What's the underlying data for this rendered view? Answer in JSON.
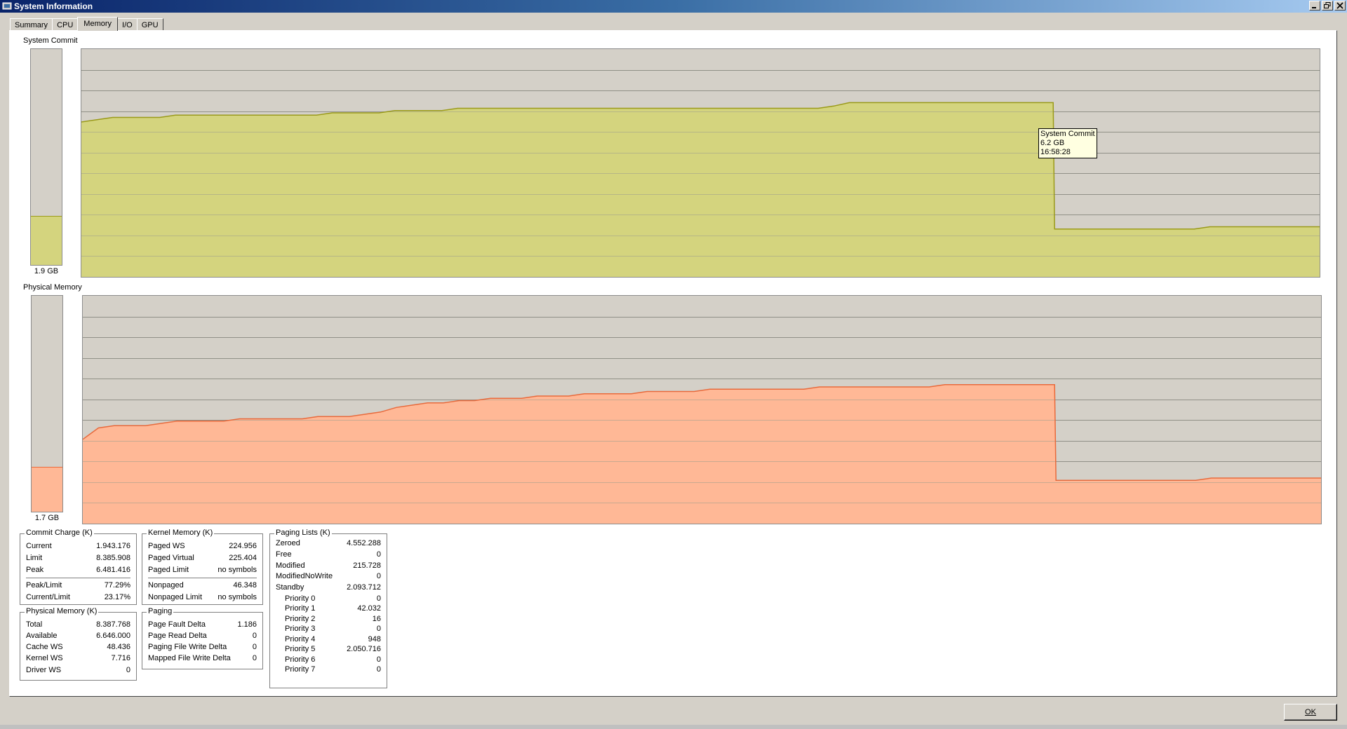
{
  "window": {
    "title": "System Information",
    "controls": [
      "minimize",
      "restore",
      "close"
    ]
  },
  "tabs": [
    {
      "label": "Summary",
      "active": false
    },
    {
      "label": "CPU",
      "active": false
    },
    {
      "label": "Memory",
      "active": true
    },
    {
      "label": "I/O",
      "active": false
    },
    {
      "label": "GPU",
      "active": false
    }
  ],
  "system_commit": {
    "title": "System Commit",
    "gauge_label": "1.9 GB",
    "gauge_fraction": 0.2273,
    "color_fill": "#d4d47e",
    "color_line": "#9a9a1a",
    "tooltip": {
      "line1": "System Commit",
      "line2": "6.2 GB",
      "line3": "16:58:28"
    }
  },
  "physical_memory": {
    "title": "Physical Memory",
    "gauge_label": "1.7 GB",
    "gauge_fraction": 0.207,
    "color_fill": "#ffb896",
    "color_line": "#e86a3c"
  },
  "chart_data": [
    {
      "type": "area",
      "name": "System Commit history",
      "ylim": [
        0,
        1
      ],
      "values": [
        0.68,
        0.69,
        0.7,
        0.7,
        0.7,
        0.7,
        0.71,
        0.71,
        0.71,
        0.71,
        0.71,
        0.71,
        0.71,
        0.71,
        0.71,
        0.71,
        0.72,
        0.72,
        0.72,
        0.72,
        0.73,
        0.73,
        0.73,
        0.73,
        0.74,
        0.74,
        0.74,
        0.74,
        0.74,
        0.74,
        0.74,
        0.74,
        0.74,
        0.74,
        0.74,
        0.74,
        0.74,
        0.74,
        0.74,
        0.74,
        0.74,
        0.74,
        0.74,
        0.74,
        0.74,
        0.74,
        0.74,
        0.74,
        0.75,
        0.765,
        0.765,
        0.765,
        0.765,
        0.765,
        0.765,
        0.765,
        0.765,
        0.765,
        0.765,
        0.765,
        0.765,
        0.765,
        0.765,
        0.21,
        0.21,
        0.21,
        0.21,
        0.21,
        0.21,
        0.21,
        0.21,
        0.21,
        0.22,
        0.22,
        0.22,
        0.22,
        0.22,
        0.22,
        0.22,
        0.22
      ],
      "cut_index": 63
    },
    {
      "type": "area",
      "name": "Physical Memory history",
      "ylim": [
        0,
        1
      ],
      "values": [
        0.37,
        0.42,
        0.43,
        0.43,
        0.43,
        0.44,
        0.45,
        0.45,
        0.45,
        0.45,
        0.46,
        0.46,
        0.46,
        0.46,
        0.46,
        0.47,
        0.47,
        0.47,
        0.48,
        0.49,
        0.51,
        0.52,
        0.53,
        0.53,
        0.54,
        0.54,
        0.55,
        0.55,
        0.55,
        0.56,
        0.56,
        0.56,
        0.57,
        0.57,
        0.57,
        0.57,
        0.58,
        0.58,
        0.58,
        0.58,
        0.59,
        0.59,
        0.59,
        0.59,
        0.59,
        0.59,
        0.59,
        0.6,
        0.6,
        0.6,
        0.6,
        0.6,
        0.6,
        0.6,
        0.6,
        0.61,
        0.61,
        0.61,
        0.61,
        0.61,
        0.61,
        0.61,
        0.61,
        0.19,
        0.19,
        0.19,
        0.19,
        0.19,
        0.19,
        0.19,
        0.19,
        0.19,
        0.2,
        0.2,
        0.2,
        0.2,
        0.2,
        0.2,
        0.2,
        0.2
      ],
      "cut_index": 63
    }
  ],
  "commit_charge": {
    "title": "Commit Charge (K)",
    "rows": [
      {
        "label": "Current",
        "value": "1.943.176"
      },
      {
        "label": "Limit",
        "value": "8.385.908"
      },
      {
        "label": "Peak",
        "value": "6.481.416"
      }
    ],
    "rows2": [
      {
        "label": "Peak/Limit",
        "value": "77.29%"
      },
      {
        "label": "Current/Limit",
        "value": "23.17%"
      }
    ]
  },
  "physical_memory_k": {
    "title": "Physical Memory (K)",
    "rows": [
      {
        "label": "Total",
        "value": "8.387.768"
      },
      {
        "label": "Available",
        "value": "6.646.000"
      },
      {
        "label": "Cache WS",
        "value": "48.436"
      },
      {
        "label": "Kernel WS",
        "value": "7.716"
      },
      {
        "label": "Driver WS",
        "value": "0"
      }
    ]
  },
  "kernel_memory": {
    "title": "Kernel Memory (K)",
    "rows": [
      {
        "label": "Paged WS",
        "value": "224.956"
      },
      {
        "label": "Paged Virtual",
        "value": "225.404"
      },
      {
        "label": "Paged Limit",
        "value": "no symbols"
      }
    ],
    "rows2": [
      {
        "label": "Nonpaged",
        "value": "46.348"
      },
      {
        "label": "Nonpaged Limit",
        "value": "no symbols"
      }
    ]
  },
  "paging": {
    "title": "Paging",
    "rows": [
      {
        "label": "Page Fault Delta",
        "value": "1.186"
      },
      {
        "label": "Page Read Delta",
        "value": "0"
      },
      {
        "label": "Paging File Write Delta",
        "value": "0"
      },
      {
        "label": "Mapped File Write Delta",
        "value": "0"
      }
    ]
  },
  "paging_lists": {
    "title": "Paging Lists (K)",
    "rows": [
      {
        "label": "Zeroed",
        "value": "4.552.288"
      },
      {
        "label": "Free",
        "value": "0"
      },
      {
        "label": "Modified",
        "value": "215.728"
      },
      {
        "label": "ModifiedNoWrite",
        "value": "0"
      },
      {
        "label": "Standby",
        "value": "2.093.712"
      }
    ],
    "priorities": [
      {
        "label": "Priority 0",
        "value": "0"
      },
      {
        "label": "Priority 1",
        "value": "42.032"
      },
      {
        "label": "Priority 2",
        "value": "16"
      },
      {
        "label": "Priority 3",
        "value": "0"
      },
      {
        "label": "Priority 4",
        "value": "948"
      },
      {
        "label": "Priority 5",
        "value": "2.050.716"
      },
      {
        "label": "Priority 6",
        "value": "0"
      },
      {
        "label": "Priority 7",
        "value": "0"
      }
    ]
  },
  "ok_button": {
    "label": "OK"
  }
}
